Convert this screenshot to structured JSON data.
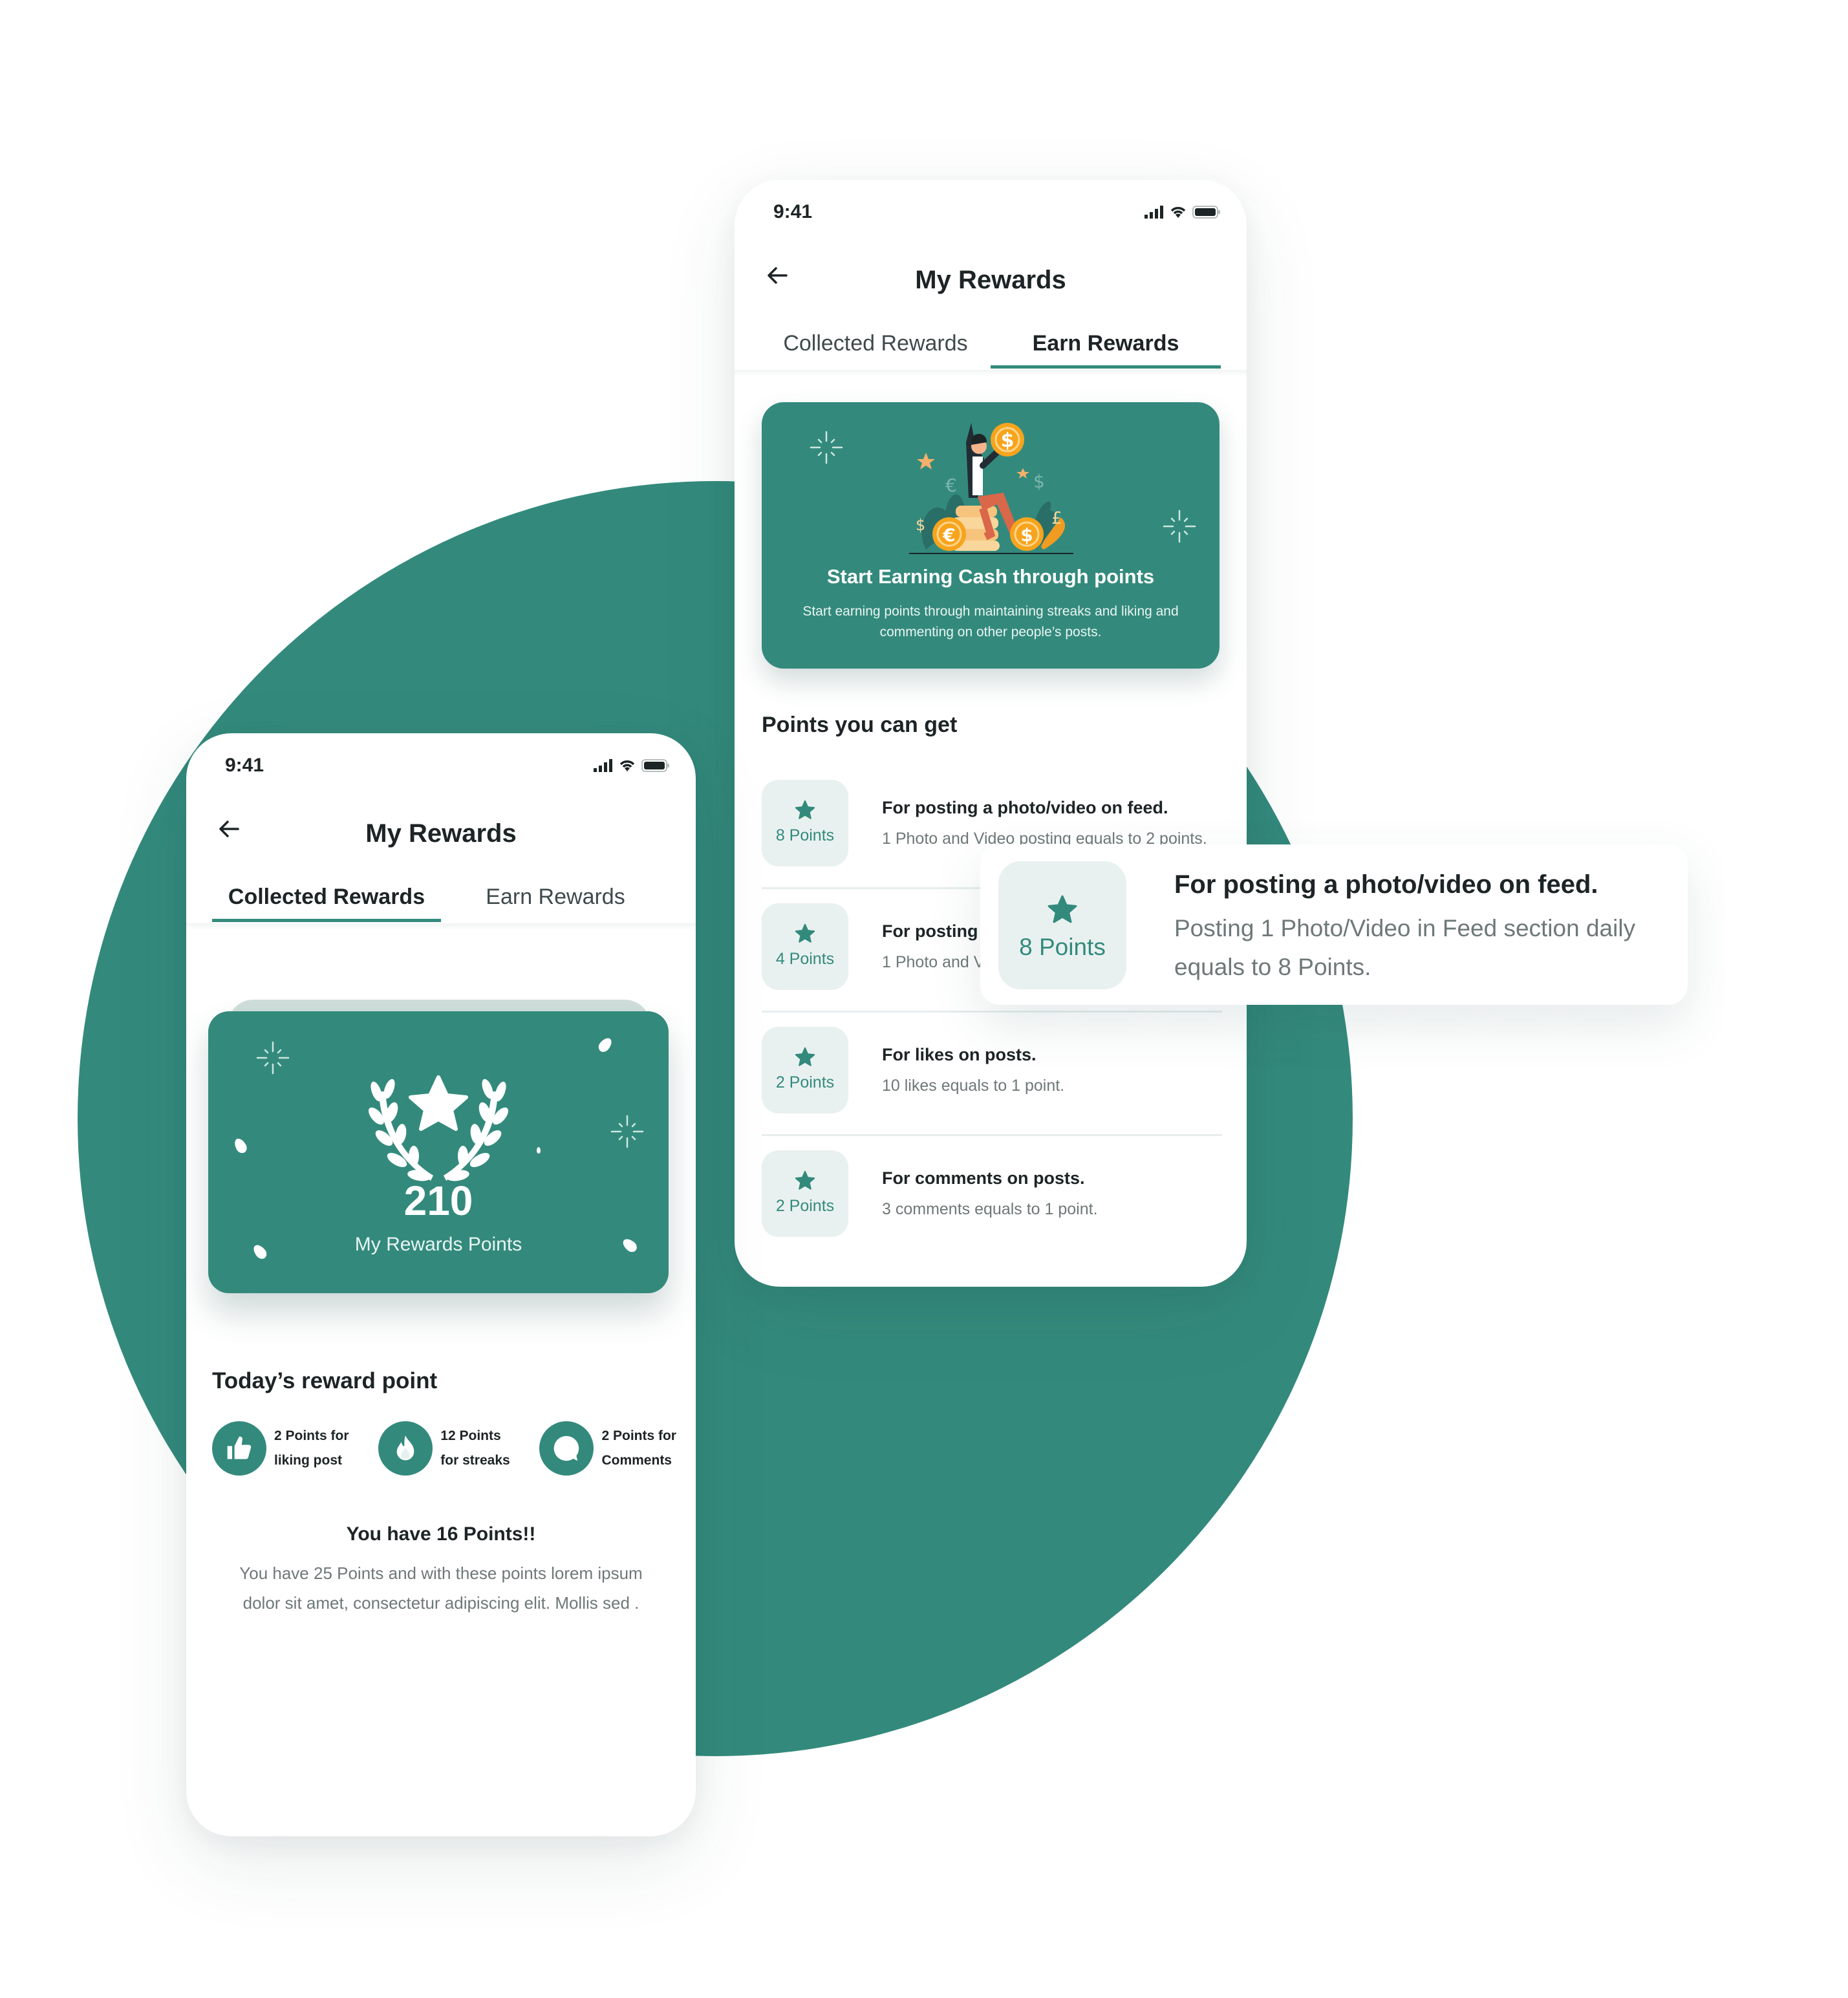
{
  "theme": {
    "accent": "#338a7c",
    "badge_bg": "#e9f1f0",
    "coin": "#f7a41d"
  },
  "earn_screen": {
    "status_time": "9:41",
    "title": "My Rewards",
    "tabs": [
      {
        "label": "Collected Rewards",
        "active": false
      },
      {
        "label": "Earn Rewards",
        "active": true
      }
    ],
    "banner": {
      "title": "Start Earning Cash through points",
      "subtitle": "Start earning points through maintaining streaks and liking and commenting on other people’s posts."
    },
    "section_title": "Points you can get",
    "rewards": [
      {
        "points": "8 Points",
        "title": "For posting a photo/video on feed.",
        "desc": "1 Photo and Video posting equals to 2 points."
      },
      {
        "points": "4 Points",
        "title": "For posting",
        "desc": "1 Photo and V"
      },
      {
        "points": "2 Points",
        "title": "For  likes on posts.",
        "desc": "10 likes equals to 1 point."
      },
      {
        "points": "2 Points",
        "title": "For comments on posts.",
        "desc": "3 comments equals to 1 point."
      }
    ]
  },
  "popup": {
    "points": "8 Points",
    "title": "For posting a photo/video on feed.",
    "desc": "Posting 1 Photo/Video in Feed section daily equals to 8 Points."
  },
  "collected_screen": {
    "status_time": "9:41",
    "title": "My Rewards",
    "tabs": [
      {
        "label": "Collected Rewards",
        "active": true
      },
      {
        "label": "Earn Rewards",
        "active": false
      }
    ],
    "points_value": "210",
    "points_label": "My Rewards Points",
    "today_title": "Today’s reward point",
    "today_items": [
      {
        "icon": "thumbs-up-icon",
        "line1": "2 Points for",
        "line2": "liking post"
      },
      {
        "icon": "flame-icon",
        "line1": "12 Points",
        "line2": "for streaks"
      },
      {
        "icon": "comment-icon",
        "line1": "2 Points for",
        "line2": "Comments"
      }
    ],
    "have_title": "You have 16 Points!!",
    "have_desc": "You have 25 Points and with these points lorem ipsum dolor sit amet, consectetur adipiscing elit. Mollis sed ."
  }
}
